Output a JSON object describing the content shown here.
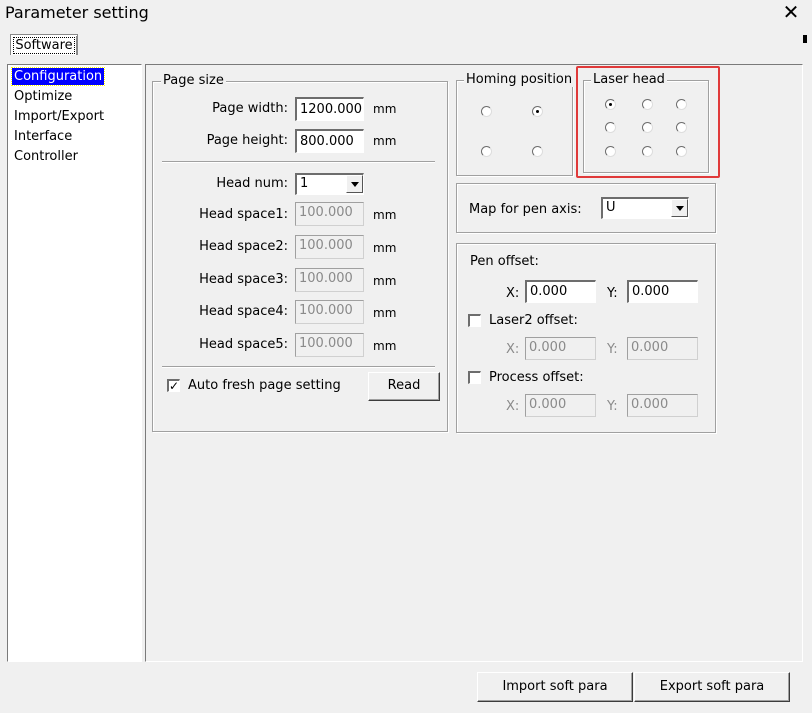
{
  "window": {
    "title": "Parameter setting",
    "close_symbol": "✕"
  },
  "tabs": [
    {
      "label": "Software",
      "selected": true
    }
  ],
  "sidebar": {
    "items": [
      {
        "label": "Configuration",
        "selected": true
      },
      {
        "label": "Optimize"
      },
      {
        "label": "Import/Export"
      },
      {
        "label": "Interface"
      },
      {
        "label": "Controller"
      }
    ]
  },
  "page_size": {
    "legend": "Page size",
    "width_label": "Page width:",
    "width_value": "1200.000",
    "width_unit": "mm",
    "height_label": "Page height:",
    "height_value": "800.000",
    "height_unit": "mm",
    "head_num_label": "Head num:",
    "head_num_value": "1",
    "head_spaces": [
      {
        "label": "Head space1:",
        "value": "100.000",
        "unit": "mm"
      },
      {
        "label": "Head space2:",
        "value": "100.000",
        "unit": "mm"
      },
      {
        "label": "Head space3:",
        "value": "100.000",
        "unit": "mm"
      },
      {
        "label": "Head space4:",
        "value": "100.000",
        "unit": "mm"
      },
      {
        "label": "Head space5:",
        "value": "100.000",
        "unit": "mm"
      }
    ],
    "auto_fresh_label": "Auto fresh page setting",
    "auto_fresh_checked": true,
    "read_button": "Read"
  },
  "homing": {
    "legend": "Homing position",
    "selected_index": 1
  },
  "laser_head": {
    "legend": "Laser head",
    "selected_index": 0,
    "highlight_color": "#e03a3a"
  },
  "pen_axis": {
    "label": "Map for pen axis:",
    "value": "U"
  },
  "offsets": {
    "pen_label": "Pen offset:",
    "pen_x_label": "X:",
    "pen_x": "0.000",
    "pen_y_label": "Y:",
    "pen_y": "0.000",
    "laser2_label": "Laser2 offset:",
    "laser2_checked": false,
    "laser2_x_label": "X:",
    "laser2_x": "0.000",
    "laser2_y_label": "Y:",
    "laser2_y": "0.000",
    "process_label": "Process offset:",
    "process_checked": false,
    "process_x_label": "X:",
    "process_x": "0.000",
    "process_y_label": "Y:",
    "process_y": "0.000"
  },
  "footer": {
    "import_button": "Import soft para",
    "export_button": "Export soft para"
  },
  "colors": {
    "selection": "#0000ff",
    "face": "#f0f0f0"
  }
}
